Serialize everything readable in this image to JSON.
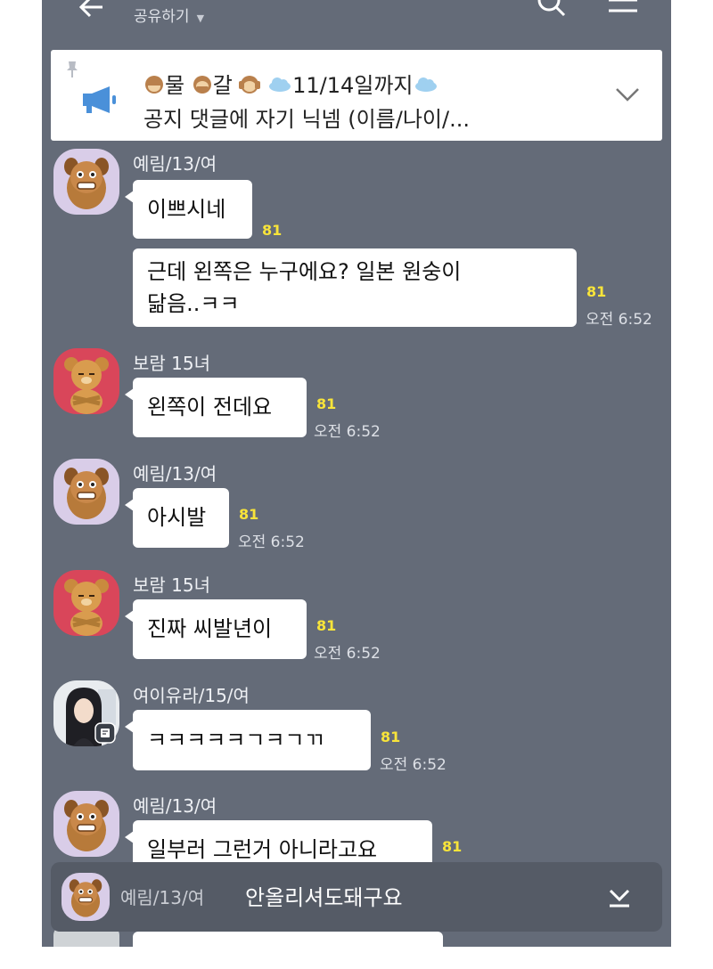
{
  "header": {
    "back_icon": "back-arrow-icon",
    "share_label": "공유하기",
    "share_caret": "▼",
    "search_icon": "search-icon",
    "menu_icon": "hamburger-menu-icon"
  },
  "notice": {
    "pin_icon": "pin-icon",
    "megaphone_icon": "megaphone-icon",
    "title_parts": [
      "물",
      "갈",
      "11/14일까지"
    ],
    "line2": "공지 댓글에 자기 닉넴 (이름/나이/...",
    "expand_icon": "chevron-down-icon"
  },
  "messages": [
    {
      "sender": "예림/13/여",
      "bubbles": [
        {
          "text": "이쁘시네",
          "count": "81",
          "time": ""
        },
        {
          "text_lines": [
            "근데 왼쪽은 누구에요? 일본 원숭이",
            "닮음..ㅋㅋ"
          ],
          "count": "81",
          "time": "오전 6:52"
        }
      ]
    },
    {
      "sender": "보람 15녀",
      "bubbles": [
        {
          "text": "왼쪽이 전데요",
          "count": "81",
          "time": "오전 6:52"
        }
      ]
    },
    {
      "sender": "예림/13/여",
      "bubbles": [
        {
          "text": "아시발",
          "count": "81",
          "time": "오전 6:52"
        }
      ]
    },
    {
      "sender": "보람 15녀",
      "bubbles": [
        {
          "text": "진짜 씨발년이",
          "count": "81",
          "time": "오전 6:52"
        }
      ]
    },
    {
      "sender": "여이유라/15/여",
      "bubbles": [
        {
          "text": "ㅋㅋㅋㅋㅋㄱㅋㄱㄲ",
          "count": "81",
          "time": "오전 6:52"
        }
      ]
    },
    {
      "sender": "예림/13/여",
      "bubbles": [
        {
          "text": "일부러 그런거 아니라고요",
          "count": "81",
          "time": ""
        }
      ]
    }
  ],
  "preview": {
    "sender": "예림/13/여",
    "text": "안올리셔도돼구요",
    "down_icon": "scroll-to-bottom-icon"
  },
  "colors": {
    "chat_background": "#646b78",
    "bubble": "#ffffff",
    "unread_count": "#f8e43a"
  }
}
